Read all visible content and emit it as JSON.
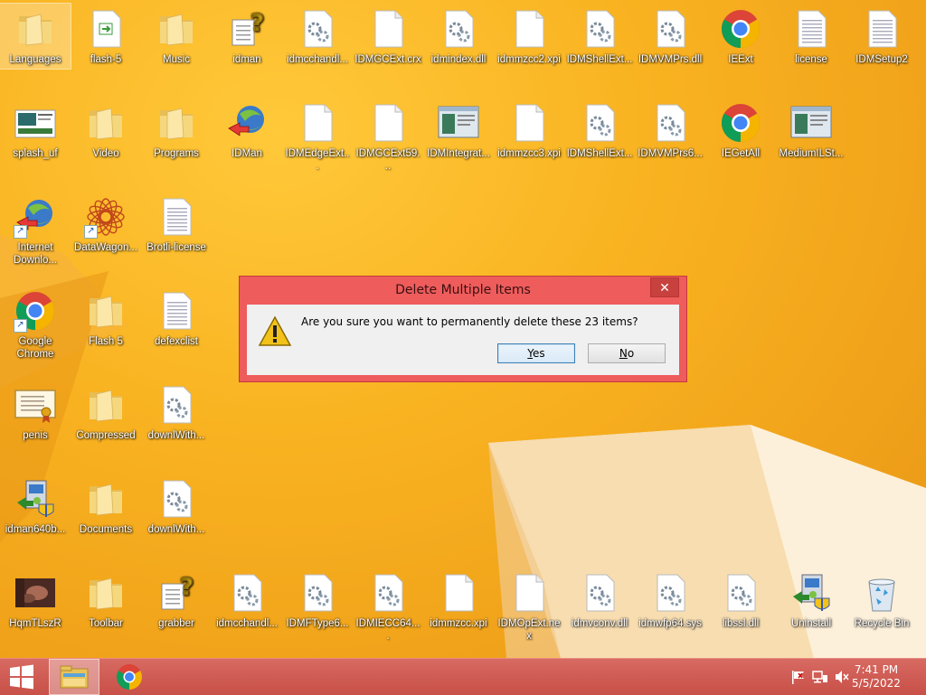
{
  "desktop": {
    "icons": [
      {
        "label": "Languages",
        "type": "folder",
        "selected": true
      },
      {
        "label": "flash-5",
        "type": "doc-green"
      },
      {
        "label": "Music",
        "type": "folder"
      },
      {
        "label": "idman",
        "type": "help"
      },
      {
        "label": "idmcchandl...",
        "type": "dll"
      },
      {
        "label": "IDMGCExt.crx",
        "type": "file"
      },
      {
        "label": "idmindex.dll",
        "type": "dll"
      },
      {
        "label": "idmmzcc2.xpi",
        "type": "file"
      },
      {
        "label": "IDMShellExt...",
        "type": "dll"
      },
      {
        "label": "IDMVMPrs.dll",
        "type": "dll"
      },
      {
        "label": "IEExt",
        "type": "chrome"
      },
      {
        "label": "license",
        "type": "text"
      },
      {
        "label": "IDMSetup2",
        "type": "text"
      },
      {
        "label": "splash_uf",
        "type": "image"
      },
      {
        "label": "Video",
        "type": "folder"
      },
      {
        "label": "Programs",
        "type": "folder"
      },
      {
        "label": "IDMan",
        "type": "idm"
      },
      {
        "label": "IDMEdgeExt...",
        "type": "file"
      },
      {
        "label": "IDMGCExt59...",
        "type": "file"
      },
      {
        "label": "IDMIntegrat...",
        "type": "window"
      },
      {
        "label": "idmmzcc3.xpi",
        "type": "file"
      },
      {
        "label": "IDMShellExt...",
        "type": "dll"
      },
      {
        "label": "IDMVMPrs6...",
        "type": "dll"
      },
      {
        "label": "IEGetAll",
        "type": "chrome"
      },
      {
        "label": "MediumILSt...",
        "type": "window"
      },
      {
        "label": "Internet Downlo...",
        "type": "idm",
        "shortcut": true
      },
      {
        "label": "DataWagon...",
        "type": "mandala",
        "shortcut": true
      },
      {
        "label": "Brotli-license",
        "type": "text"
      },
      {
        "label": "Google Chrome",
        "type": "chrome",
        "shortcut": true
      },
      {
        "label": "Flash 5",
        "type": "folder"
      },
      {
        "label": "defexclist",
        "type": "text"
      },
      {
        "label": "penis",
        "type": "certificate"
      },
      {
        "label": "Compressed",
        "type": "folder"
      },
      {
        "label": "downlWith...",
        "type": "dll"
      },
      {
        "label": "idman640b...",
        "type": "installer"
      },
      {
        "label": "Documents",
        "type": "folder"
      },
      {
        "label": "downlWith...",
        "type": "dll"
      },
      {
        "label": "HqmTLszR",
        "type": "photo"
      },
      {
        "label": "Toolbar",
        "type": "folder"
      },
      {
        "label": "grabber",
        "type": "help"
      },
      {
        "label": "idmcchandl...",
        "type": "dll"
      },
      {
        "label": "IDMFType6...",
        "type": "dll"
      },
      {
        "label": "IDMIECC64....",
        "type": "dll"
      },
      {
        "label": "idmmzcc.xpi",
        "type": "file"
      },
      {
        "label": "IDMOpExt.nex",
        "type": "file"
      },
      {
        "label": "idmvconv.dll",
        "type": "dll"
      },
      {
        "label": "idmwfp64.sys",
        "type": "dll"
      },
      {
        "label": "libssl.dll",
        "type": "dll"
      },
      {
        "label": "Uninstall",
        "type": "installer"
      },
      {
        "label": "Recycle Bin",
        "type": "recycle"
      }
    ]
  },
  "dialog": {
    "title": "Delete Multiple Items",
    "close_glyph": "✕",
    "message": "Are you sure you want to permanently delete these 23 items?",
    "yes_hotkey": "Y",
    "yes_rest": "es",
    "no_hotkey": "N",
    "no_rest": "o"
  },
  "taskbar": {
    "time": "7:41 PM",
    "date": "5/5/2022"
  },
  "colors": {
    "dialog_frame": "#ee5c5c",
    "taskbar": "#c85048",
    "desktop": "#f9b321"
  }
}
